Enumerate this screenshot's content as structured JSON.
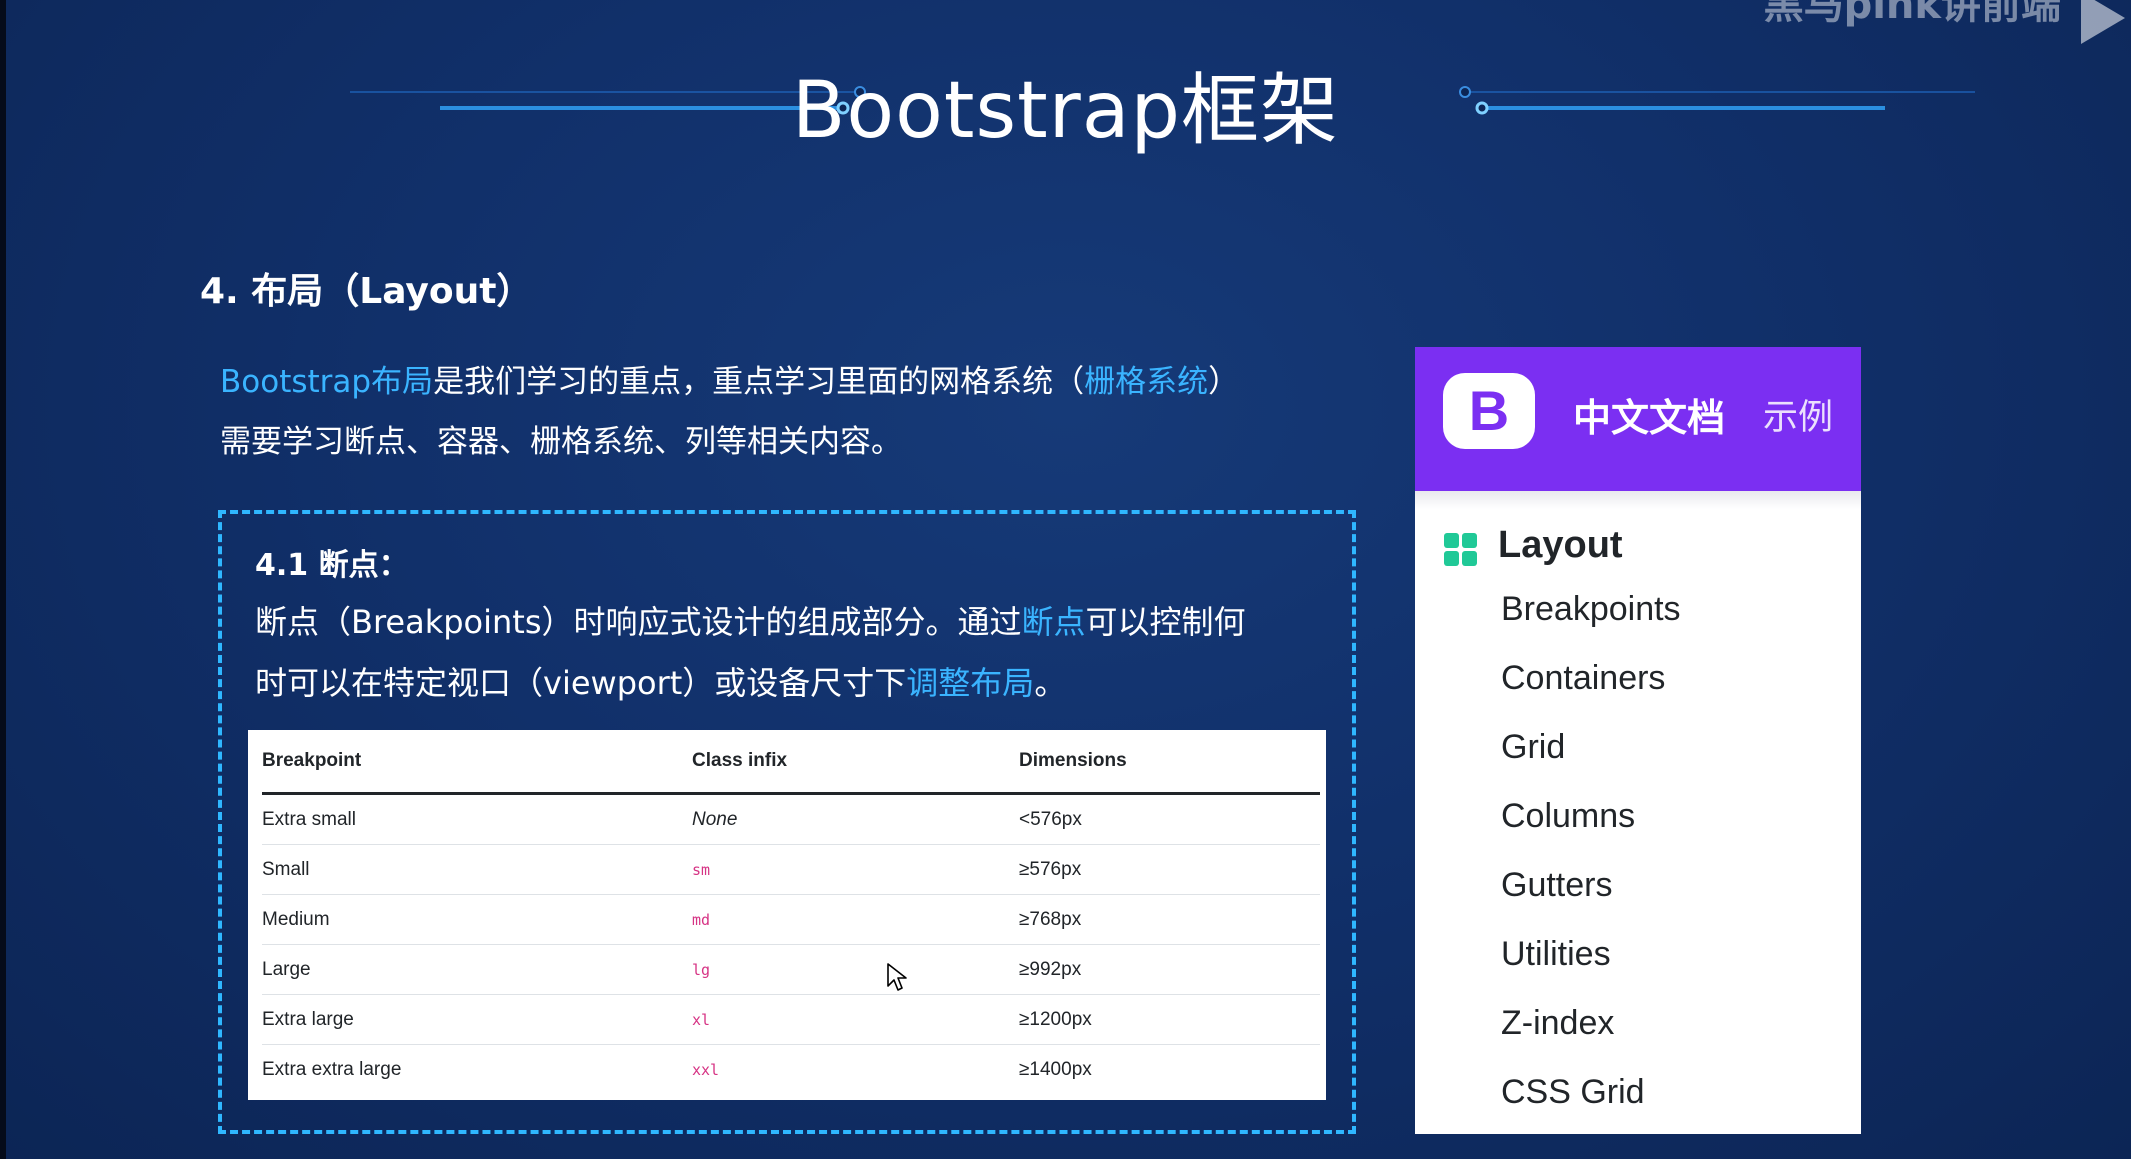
{
  "slide": {
    "title": "Bootstrap框架",
    "watermark": "黑马pink讲前端",
    "section_heading": "4. 布局（Layout）",
    "intro": {
      "link1": "Bootstrap布局",
      "text1": "是我们学习的重点，重点学习里面的网格系统（",
      "link2": "栅格系统",
      "text2": "）",
      "line2": "需要学习断点、容器、栅格系统、列等相关内容。"
    },
    "breakpoints_section": {
      "heading": "4.1 断点：",
      "text1": "断点（Breakpoints）时响应式设计的组成部分。通过",
      "link1": "断点",
      "text2": "可以控制何",
      "text3": "时可以在特定视口（viewport）或设备尺寸下",
      "link2": "调整布局",
      "text4": "。"
    }
  },
  "table": {
    "headers": [
      "Breakpoint",
      "Class infix",
      "Dimensions"
    ],
    "rows": [
      {
        "breakpoint": "Extra small",
        "infix": "None",
        "dimensions": "<576px"
      },
      {
        "breakpoint": "Small",
        "infix": "sm",
        "dimensions": "≥576px"
      },
      {
        "breakpoint": "Medium",
        "infix": "md",
        "dimensions": "≥768px"
      },
      {
        "breakpoint": "Large",
        "infix": "lg",
        "dimensions": "≥992px"
      },
      {
        "breakpoint": "Extra large",
        "infix": "xl",
        "dimensions": "≥1200px"
      },
      {
        "breakpoint": "Extra extra large",
        "infix": "xxl",
        "dimensions": "≥1400px"
      }
    ]
  },
  "sidebar": {
    "logo": "B",
    "docs": "中文文档",
    "examples": "示例",
    "section": "Layout",
    "items": [
      "Breakpoints",
      "Containers",
      "Grid",
      "Columns",
      "Gutters",
      "Utilities",
      "Z-index",
      "CSS Grid"
    ]
  },
  "colors": {
    "background": "#11306a",
    "highlight": "#3ab4ff",
    "dashed_border": "#2fb7ff",
    "bootstrap_purple": "#7b2ff2",
    "layout_icon": "#20c997",
    "code_pink": "#d63384"
  }
}
